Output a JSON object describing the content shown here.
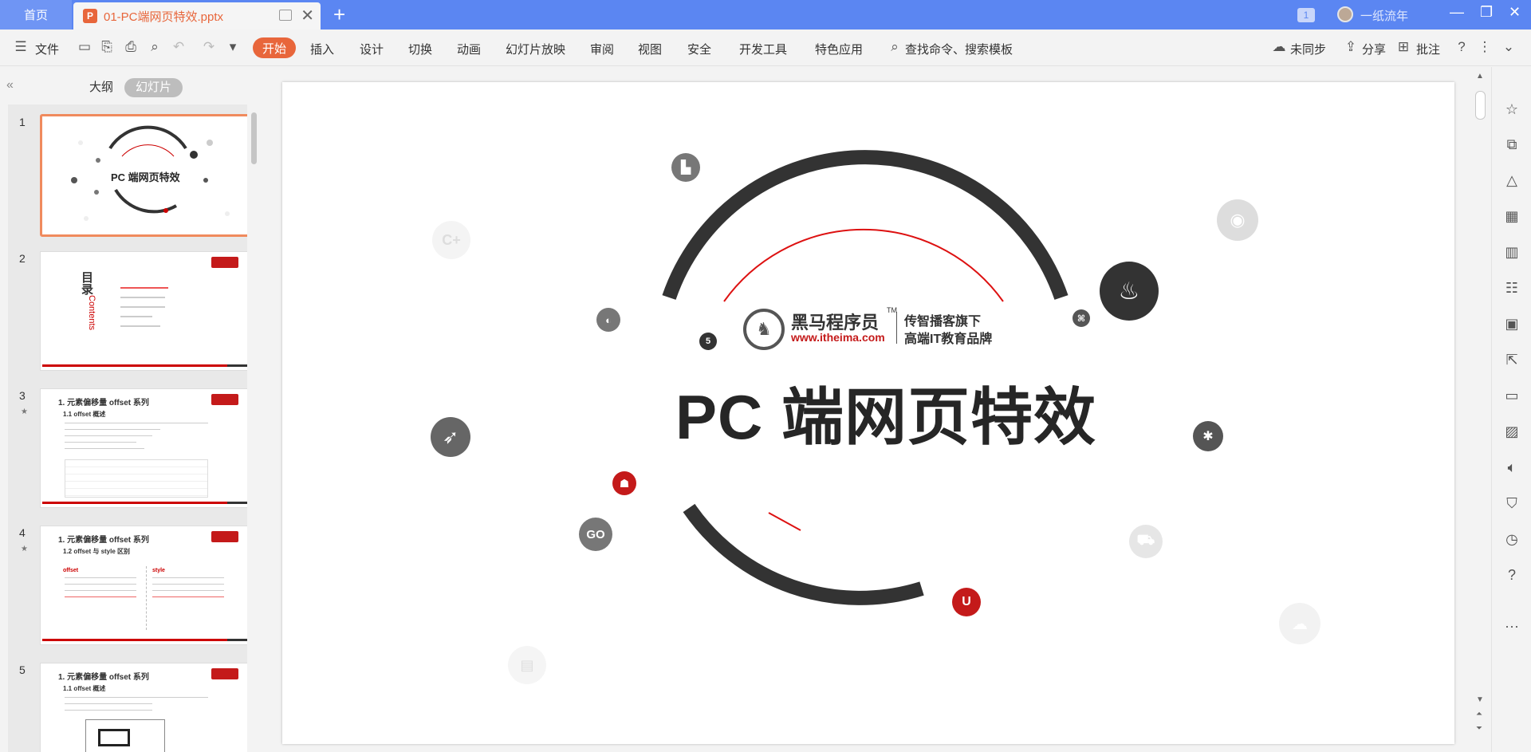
{
  "titlebar": {
    "home_tab": "首页",
    "doc_tab_title": "01-PC端网页特效.pptx",
    "badge": "1",
    "user_name": "一纸流年"
  },
  "ribbon": {
    "file_menu": "文件",
    "tabs": [
      "开始",
      "插入",
      "设计",
      "切换",
      "动画",
      "幻灯片放映",
      "审阅",
      "视图",
      "安全",
      "开发工具",
      "特色应用"
    ],
    "search": "查找命令、搜索模板",
    "sync": "未同步",
    "share": "分享",
    "comment": "批注"
  },
  "leftpane": {
    "tab_outline": "大纲",
    "tab_slides": "幻灯片",
    "slides": [
      {
        "num": "1",
        "title": "PC 端网页特效"
      },
      {
        "num": "2",
        "title": "目录",
        "subtitle": "Contents"
      },
      {
        "num": "3",
        "title": "1. 元素偏移量 offset 系列",
        "subtitle": "1.1 offset 概述"
      },
      {
        "num": "4",
        "title": "1. 元素偏移量 offset 系列",
        "subtitle": "1.2 offset 与 style 区别",
        "col1": "offset",
        "col2": "style"
      },
      {
        "num": "5",
        "title": "1. 元素偏移量 offset 系列",
        "subtitle": "1.1 offset 概述"
      }
    ]
  },
  "slide": {
    "main_title": "PC 端网页特效",
    "logo_name": "黑马程序员",
    "logo_tm": "TM",
    "logo_url": "www.itheima.com",
    "slogan_line1": "传智播客旗下",
    "slogan_line2": "高端IT教育品牌",
    "go_label": "GO"
  },
  "colors": {
    "titlebar": "#5b86f2",
    "accent": "#e8663b",
    "brand_red": "#c41a1a",
    "arc_dark": "#333333"
  }
}
